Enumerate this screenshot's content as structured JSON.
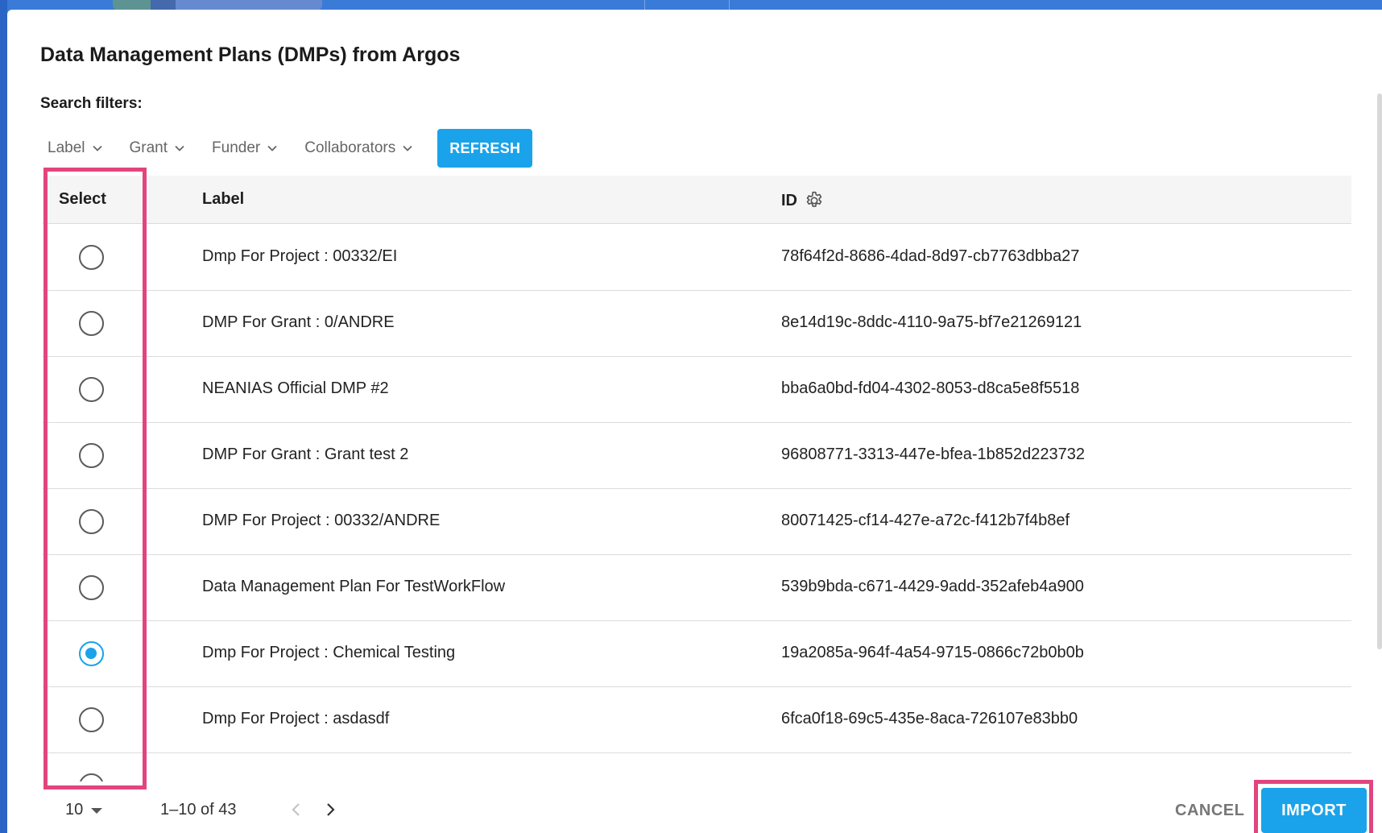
{
  "dialog": {
    "title": "Data Management Plans (DMPs) from Argos",
    "filters_label": "Search filters:",
    "filters": [
      {
        "label": "Label"
      },
      {
        "label": "Grant"
      },
      {
        "label": "Funder"
      },
      {
        "label": "Collaborators"
      }
    ],
    "refresh_label": "REFRESH"
  },
  "table": {
    "columns": {
      "select": "Select",
      "label": "Label",
      "id": "ID"
    },
    "rows": [
      {
        "label": "Dmp For Project : 00332/EI",
        "id": "78f64f2d-8686-4dad-8d97-cb7763dbba27",
        "selected": false
      },
      {
        "label": "DMP For Grant : 0/ANDRE",
        "id": "8e14d19c-8ddc-4110-9a75-bf7e21269121",
        "selected": false
      },
      {
        "label": "NEANIAS Official DMP #2",
        "id": "bba6a0bd-fd04-4302-8053-d8ca5e8f5518",
        "selected": false
      },
      {
        "label": "DMP For Grant : Grant test 2",
        "id": "96808771-3313-447e-bfea-1b852d223732",
        "selected": false
      },
      {
        "label": "DMP For Project : 00332/ANDRE",
        "id": "80071425-cf14-427e-a72c-f412b7f4b8ef",
        "selected": false
      },
      {
        "label": "Data Management Plan For TestWorkFlow",
        "id": "539b9bda-c671-4429-9add-352afeb4a900",
        "selected": false
      },
      {
        "label": "Dmp For Project : Chemical Testing",
        "id": "19a2085a-964f-4a54-9715-0866c72b0b0b",
        "selected": true
      },
      {
        "label": "Dmp For Project : asdasdf",
        "id": "6fca0f18-69c5-435e-8aca-726107e83bb0",
        "selected": false
      }
    ]
  },
  "paginator": {
    "page_size": "10",
    "range": "1–10 of 43"
  },
  "actions": {
    "cancel_label": "CANCEL",
    "import_label": "IMPORT"
  },
  "colors": {
    "accent": "#1aa3ea",
    "highlight": "#e2457e"
  },
  "icons": {
    "filter_chevron": "chevron-down-icon",
    "id_settings": "gear-icon",
    "prev_page": "chevron-left-icon",
    "next_page": "chevron-right-icon"
  }
}
